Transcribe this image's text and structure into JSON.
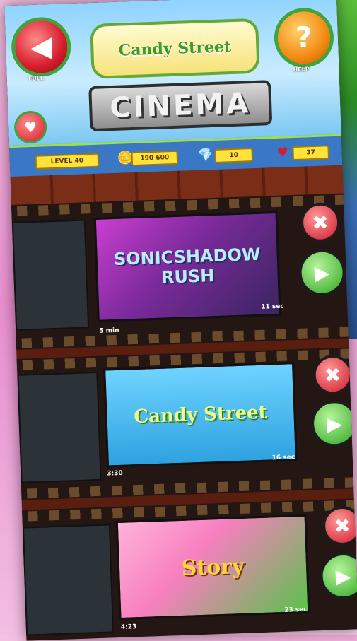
{
  "header": {
    "title": "CINEMA",
    "logo_text": "Candy Street",
    "left_button_caption": "FULL",
    "right_button_caption": "HELP",
    "help_symbol": "?",
    "back_symbol": "◀",
    "heart_symbol": "♥"
  },
  "status": {
    "level": "LEVEL 40",
    "coins": "190 600",
    "gems": "10",
    "lives": "37"
  },
  "videos": [
    {
      "title": "SONICSHADOW RUSH",
      "left_label": "5 min",
      "right_label": "11 sec"
    },
    {
      "title": "Candy Street",
      "left_label": "3:30",
      "right_label": "16 sec"
    },
    {
      "title": "Story",
      "left_label": "4:23",
      "right_label": "23 sec"
    }
  ],
  "icons": {
    "close": "✖",
    "play": "▶"
  }
}
